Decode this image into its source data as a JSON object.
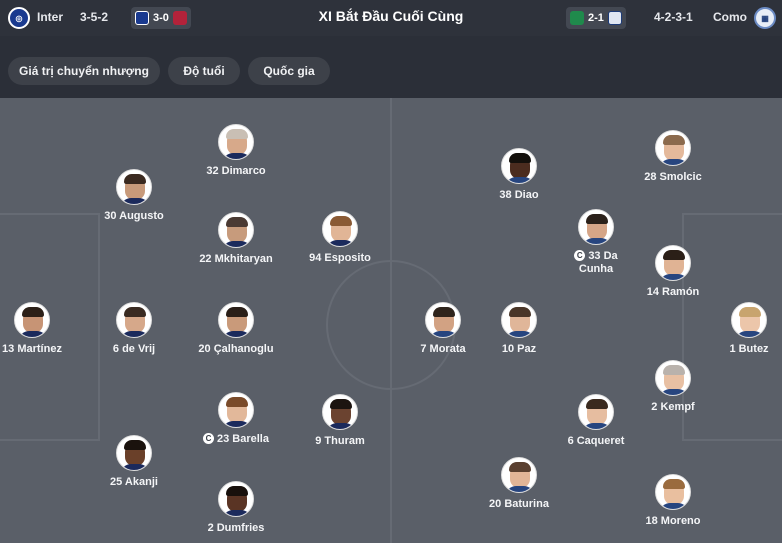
{
  "header": {
    "title": "XI Bắt Đầu Cuối Cùng",
    "home_team": "Inter",
    "home_formation": "3-5-2",
    "home_last_result": "3-0",
    "away_last_result": "2-1",
    "away_formation": "4-2-3-1",
    "away_team": "Como"
  },
  "filters": [
    "Giá trị chuyển nhượng",
    "Độ tuổi",
    "Quốc gia"
  ],
  "home_players": [
    {
      "label": "32 Dimarco",
      "captain": false
    },
    {
      "label": "30 Augusto",
      "captain": false
    },
    {
      "label": "22 Mkhitaryan",
      "captain": false
    },
    {
      "label": "94 Esposito",
      "captain": false
    },
    {
      "label": "13 Martínez",
      "captain": false
    },
    {
      "label": "6 de Vrij",
      "captain": false
    },
    {
      "label": "20 Çalhanoglu",
      "captain": false
    },
    {
      "label": "23 Barella",
      "captain": true
    },
    {
      "label": "9 Thuram",
      "captain": false
    },
    {
      "label": "25 Akanji",
      "captain": false
    },
    {
      "label": "2 Dumfries",
      "captain": false
    }
  ],
  "away_players": [
    {
      "label": "28 Smolcic",
      "captain": false
    },
    {
      "label": "38 Diao",
      "captain": false
    },
    {
      "label": "33 Da Cunha",
      "captain": true
    },
    {
      "label": "14 Ramón",
      "captain": false
    },
    {
      "label": "7 Morata",
      "captain": false
    },
    {
      "label": "10 Paz",
      "captain": false
    },
    {
      "label": "1 Butez",
      "captain": false
    },
    {
      "label": "2 Kempf",
      "captain": false
    },
    {
      "label": "6 Caqueret",
      "captain": false
    },
    {
      "label": "20 Baturina",
      "captain": false
    },
    {
      "label": "18 Moreno",
      "captain": false
    }
  ],
  "colors": {
    "pitch": "#5a5f68",
    "header_bg": "#2e323b",
    "inter_blue": "#1a3a8f",
    "como_blue": "#1d3b78",
    "sassuolo_green": "#1f8a4c",
    "cagliari_red": "#b3223a"
  }
}
